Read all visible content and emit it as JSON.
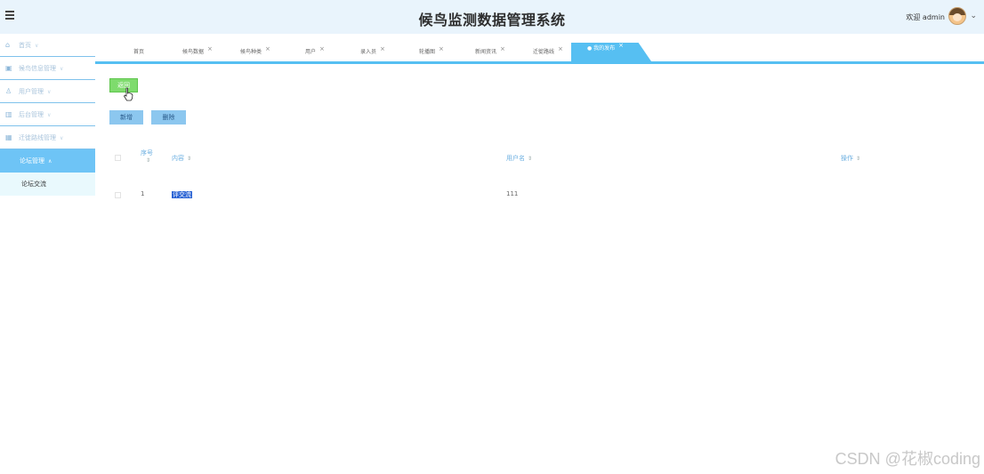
{
  "header": {
    "title": "候鸟监测数据管理系统",
    "welcome": "欢迎 admin"
  },
  "sidebar": {
    "items": [
      {
        "label": "首页",
        "icon": "home-icon"
      },
      {
        "label": "候鸟信息管理",
        "icon": "bird-info-icon"
      },
      {
        "label": "用户管理",
        "icon": "user-icon"
      },
      {
        "label": "后台管理",
        "icon": "admin-icon"
      },
      {
        "label": "迁徙路线管理",
        "icon": "grid-icon"
      },
      {
        "label": "论坛管理",
        "icon": ""
      }
    ],
    "subitem": "论坛交流"
  },
  "tabs": [
    {
      "label": "首页",
      "closable": false
    },
    {
      "label": "候鸟数据",
      "closable": true
    },
    {
      "label": "候鸟种类",
      "closable": true
    },
    {
      "label": "用户",
      "closable": true
    },
    {
      "label": "录入员",
      "closable": true
    },
    {
      "label": "轮播图",
      "closable": true
    },
    {
      "label": "新闻资讯",
      "closable": true
    },
    {
      "label": "迁徙路线",
      "closable": true
    },
    {
      "label": "● 我的发布",
      "closable": true,
      "active": true
    }
  ],
  "buttons": {
    "back": "返回",
    "add": "新增",
    "delete": "删除"
  },
  "table": {
    "columns": [
      "序号",
      "内容",
      "用户名",
      "操作"
    ],
    "rows": [
      {
        "index": "1",
        "content": "评交流",
        "username": "111"
      }
    ]
  },
  "watermark": "CSDN @花椒coding",
  "colors": {
    "accent": "#56bff2",
    "sidebar_active": "#6ec4f6",
    "back_button": "#7edb6d",
    "header_bg": "#e9f4fc"
  }
}
